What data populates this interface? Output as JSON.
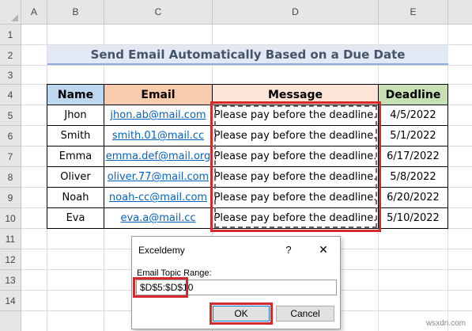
{
  "columns": [
    "A",
    "B",
    "C",
    "D",
    "E"
  ],
  "rows": [
    "1",
    "2",
    "3",
    "4",
    "5",
    "6",
    "7",
    "8",
    "9",
    "10",
    "11",
    "12",
    "13",
    "14"
  ],
  "title": "Send Email Automatically Based on a Due Date",
  "table": {
    "headers": {
      "name": "Name",
      "email": "Email",
      "message": "Message",
      "deadline": "Deadline"
    },
    "rows": [
      {
        "name": "Jhon",
        "email": "jhon.ab@mail.com",
        "message": "Please pay before the deadline.",
        "deadline": "4/5/2022"
      },
      {
        "name": "Smith",
        "email": "smith.01@mail.cc",
        "message": "Please pay before the deadline.",
        "deadline": "5/1/2022"
      },
      {
        "name": "Emma",
        "email": "emma.def@mail.org",
        "message": "Please pay before the deadline.",
        "deadline": "6/17/2022"
      },
      {
        "name": "Oliver",
        "email": "oliver.77@mail.com",
        "message": "Please pay before the deadline.",
        "deadline": "5/8/2022"
      },
      {
        "name": "Noah",
        "email": "noah-cc@mail.com",
        "message": "Please pay before the deadline.",
        "deadline": "6/20/2022"
      },
      {
        "name": "Eva",
        "email": "eva.a@mail.cc",
        "message": "Please pay before the deadline.",
        "deadline": "5/10/2022"
      }
    ]
  },
  "dialog": {
    "title": "Exceldemy",
    "help": "?",
    "close": "✕",
    "label": "Email Topic Range:",
    "input_value": "$D$5:$D$10",
    "ok": "OK",
    "cancel": "Cancel"
  },
  "watermark": "wsxdn.com",
  "colors": {
    "name_header": "#bdd7ee",
    "email_header": "#f8cbad",
    "message_header": "#fce4d6",
    "deadline_header": "#c6e0b4",
    "highlight": "#d42a2a"
  }
}
